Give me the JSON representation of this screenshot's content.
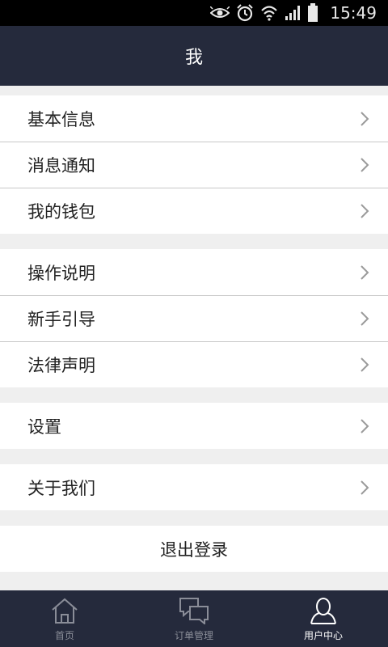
{
  "status_bar": {
    "time": "15:49",
    "icons": [
      "eye-icon",
      "alarm-icon",
      "wifi-icon",
      "signal-icon",
      "battery-icon"
    ]
  },
  "header": {
    "title": "我"
  },
  "groups": [
    {
      "items": [
        {
          "label": "基本信息"
        },
        {
          "label": "消息通知"
        },
        {
          "label": "我的钱包"
        }
      ]
    },
    {
      "items": [
        {
          "label": "操作说明"
        },
        {
          "label": "新手引导"
        },
        {
          "label": "法律声明"
        }
      ]
    },
    {
      "items": [
        {
          "label": "设置"
        }
      ]
    },
    {
      "items": [
        {
          "label": "关于我们"
        }
      ]
    }
  ],
  "logout": {
    "label": "退出登录"
  },
  "tabs": [
    {
      "label": "首页",
      "icon": "home-icon",
      "active": false
    },
    {
      "label": "订单管理",
      "icon": "chat-bubbles-icon",
      "active": false
    },
    {
      "label": "用户中心",
      "icon": "user-icon",
      "active": true
    }
  ],
  "colors": {
    "header_bg": "#252a3c",
    "page_bg": "#efefef",
    "tab_inactive": "#8a8d98",
    "tab_active": "#ffffff"
  }
}
